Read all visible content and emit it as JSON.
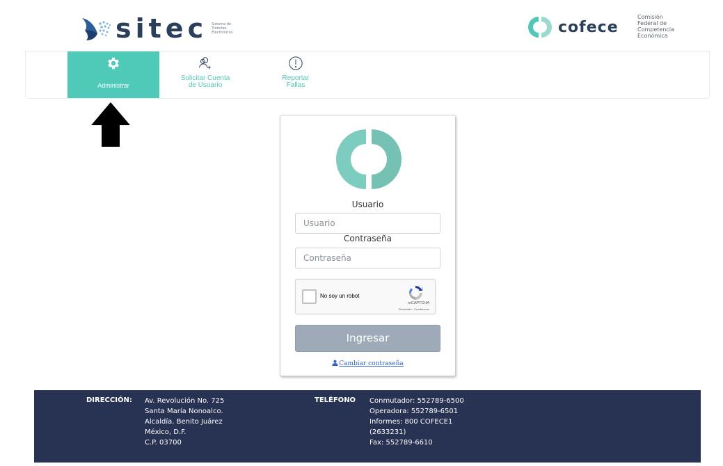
{
  "header": {
    "sitec_logo": "sitec",
    "sitec_sub": [
      "Sistema de",
      "Trámites",
      "Electrónicos"
    ],
    "cofece_logo": "cofece",
    "cofece_sub": [
      "Comisión",
      "Federal de",
      "Competencia",
      "Económica"
    ]
  },
  "nav": {
    "items": [
      {
        "label": "Administrar",
        "icon": "gear-icon",
        "active": true
      },
      {
        "label": "Solicitar Cuenta\nde Usuario",
        "icon": "add-user-icon",
        "active": false
      },
      {
        "label": "Reportar\nFallas",
        "icon": "alert-circle-icon",
        "active": false
      }
    ]
  },
  "login": {
    "usuario_label": "Usuario",
    "usuario_placeholder": "Usuario",
    "password_label": "Contraseña",
    "password_placeholder": "Contraseña",
    "captcha_text": "No soy un robot",
    "captcha_brand": "reCAPTCHA",
    "captcha_links": "Privacidad - Condiciones",
    "submit_label": "Ingresar",
    "change_password_link": "Cambiar contraseña"
  },
  "footer": {
    "direccion_label": "DIRECCIÓN:",
    "direccion_lines": [
      "Av. Revolución No. 725",
      "Santa María Nonoalco.",
      "Alcaldía. Benito Juárez",
      "México, D.F.",
      "C.P. 03700"
    ],
    "telefono_label": "TELÉFONO",
    "telefono_lines": [
      "Conmutador: 552789-6500",
      "Operadora: 552789-6501",
      "Informes: 800 COFECE1",
      "(2633231)",
      "Fax: 552789-6610"
    ]
  },
  "colors": {
    "accent": "#4fc9b8",
    "navy": "#283252",
    "button": "#9eaab8"
  }
}
